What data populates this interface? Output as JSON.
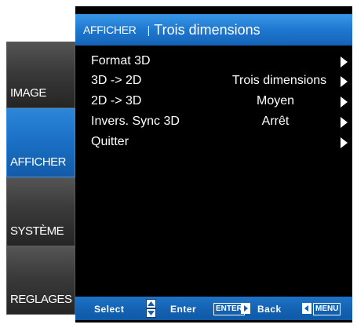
{
  "tabs": [
    {
      "label": "IMAGE",
      "active": false
    },
    {
      "label": "AFFICHER",
      "active": true
    },
    {
      "label": "SYSTÈME",
      "active": false
    },
    {
      "label": "REGLAGES",
      "active": false
    }
  ],
  "header": {
    "section": "AFFICHER",
    "separator": "|",
    "title": "Trois dimensions"
  },
  "menu": [
    {
      "label": "Format 3D",
      "value": "",
      "icon": "arrow-right-icon"
    },
    {
      "label": "3D -> 2D",
      "value": "Trois dimensions",
      "icon": "arrow-right-icon"
    },
    {
      "label": "2D -> 3D",
      "value": "Moyen",
      "icon": "arrow-right-icon"
    },
    {
      "label": "Invers. Sync 3D",
      "value": "Arrêt",
      "icon": "arrow-right-icon"
    },
    {
      "label": "Quitter",
      "value": "",
      "icon": "arrow-right-icon"
    }
  ],
  "footer": {
    "select_label": "Select",
    "enter_label": "Enter",
    "enter_key": "ENTER",
    "back_label": "Back",
    "menu_key": "MENU"
  },
  "colors": {
    "accent": "#1e78cf",
    "panel_background": "#000000",
    "tab_inactive": "#3a3a3a",
    "text": "#ffffff"
  }
}
